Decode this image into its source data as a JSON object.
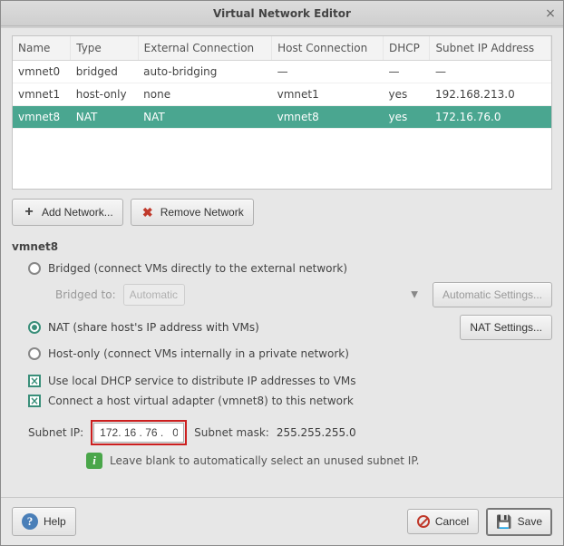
{
  "window": {
    "title": "Virtual Network Editor"
  },
  "table": {
    "headers": [
      "Name",
      "Type",
      "External Connection",
      "Host Connection",
      "DHCP",
      "Subnet IP Address"
    ],
    "rows": [
      {
        "name": "vmnet0",
        "type": "bridged",
        "ext": "auto-bridging",
        "host": "—",
        "dhcp": "—",
        "subnet": "—",
        "selected": false
      },
      {
        "name": "vmnet1",
        "type": "host-only",
        "ext": "none",
        "host": "vmnet1",
        "dhcp": "yes",
        "subnet": "192.168.213.0",
        "selected": false
      },
      {
        "name": "vmnet8",
        "type": "NAT",
        "ext": "NAT",
        "host": "vmnet8",
        "dhcp": "yes",
        "subnet": "172.16.76.0",
        "selected": true
      }
    ]
  },
  "buttons": {
    "add": "Add Network...",
    "remove": "Remove Network",
    "auto_settings": "Automatic Settings...",
    "nat_settings": "NAT Settings...",
    "help": "Help",
    "cancel": "Cancel",
    "save": "Save"
  },
  "panel": {
    "heading": "vmnet8",
    "bridged_label": "Bridged (connect VMs directly to the external network)",
    "bridged_to_label": "Bridged to:",
    "bridged_to_value": "Automatic",
    "nat_label": "NAT (share host's IP address with VMs)",
    "hostonly_label": "Host-only (connect VMs internally in a private network)",
    "dhcp_label": "Use local DHCP service to distribute IP addresses to VMs",
    "adapter_label": "Connect a host virtual adapter (vmnet8) to this network",
    "subnet_ip_label": "Subnet IP:",
    "subnet_ip_value": "172. 16 . 76 .   0",
    "subnet_mask_label": "Subnet mask:",
    "subnet_mask_value": "255.255.255.0",
    "hint": "Leave blank to automatically select an unused subnet IP."
  }
}
